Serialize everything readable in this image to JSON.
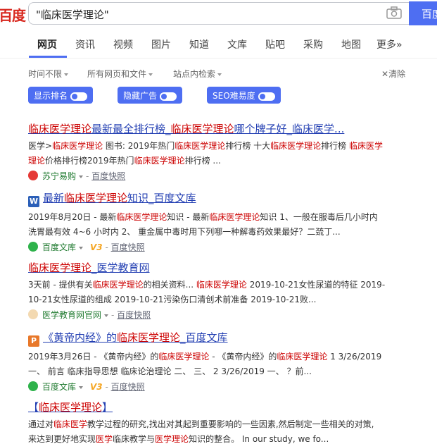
{
  "header": {
    "logo": "百度",
    "query": "\"临床医学理论\"",
    "search_btn": "百度"
  },
  "tabs": [
    "网页",
    "资讯",
    "视频",
    "图片",
    "知道",
    "文库",
    "贴吧",
    "采购",
    "地图",
    "更多»"
  ],
  "filters": [
    "时间不限",
    "所有网页和文件",
    "站点内检索"
  ],
  "clear_label": "清除",
  "toggles": [
    "显示排名",
    "隐藏广告",
    "SEO难易度"
  ],
  "results": [
    {
      "title_parts": [
        "临床医学理论",
        "最新最全排行榜_",
        "临床医学理论",
        "哪个牌子好_临床医学..."
      ],
      "abstract_lines": [
        [
          "医学>",
          "临床医学理论",
          " 图书: 2019年热门",
          "临床医学理论",
          "排行榜 十大",
          "临床医学理论",
          "排行榜 ",
          "临床医学"
        ],
        [
          "理论",
          "价格排行榜2019年热门",
          "临床医学理论",
          "排行榜 ..."
        ]
      ],
      "site": "苏宁易购",
      "snapshot": "百度快照"
    },
    {
      "icon": "W",
      "title_parts": [
        "最新",
        "临床医学理论",
        "知识_百度文库"
      ],
      "abstract_lines": [
        [
          "2019年8月20日 - 最新",
          "临床医学理论",
          "知识 - 最新",
          "临床医学理论",
          "知识 1、一般在服毒后几小时内"
        ],
        [
          "洗胃最有效 4~6 小时内 2、 重金属中毒时用下列哪一种解毒药效果最好？二巯丁..."
        ]
      ],
      "site": "百度文库",
      "badge": "V3",
      "snapshot": "百度快照"
    },
    {
      "title_parts": [
        "临床医学理论",
        "_医学教育网"
      ],
      "abstract_lines": [
        [
          "3天前 - 提供有关",
          "临床医学理论",
          "的相关资料... ",
          "临床医学理论",
          " 2019-10-21女性尿道的特征 2019-"
        ],
        [
          "10-21女性尿道的组成 2019-10-21污染伤口清创术前准备 2019-10-21败..."
        ]
      ],
      "site": "医学教育网官网",
      "snapshot": "百度快照"
    },
    {
      "icon": "P",
      "title_parts": [
        "《黄帝内经》的",
        "临床医学理论",
        "_百度文库"
      ],
      "abstract_lines": [
        [
          "2019年3月26日 - 《黄帝内经》的",
          "临床医学理论",
          " - 《黄帝内经》的",
          "临床医学理论",
          " 1 3/26/2019"
        ],
        [
          "一、 前言 临床指导思想 临床论治理论 二、 三、 2 3/26/2019 一、 ？前..."
        ]
      ],
      "site": "百度文库",
      "badge": "V3",
      "snapshot": "百度快照"
    },
    {
      "title_parts": [
        "【",
        "临床医学理论",
        "】"
      ],
      "abstract_lines": [
        [
          "通过对",
          "临床医学",
          "教学过程的研究,找出对其起到重要影响的一些因素,然后制定一些相关的对策,"
        ],
        [
          "来达到更好地实现",
          "医学",
          "临床教学与",
          "医学理论",
          "知识的整合。 In our study, we fo..."
        ]
      ]
    }
  ]
}
